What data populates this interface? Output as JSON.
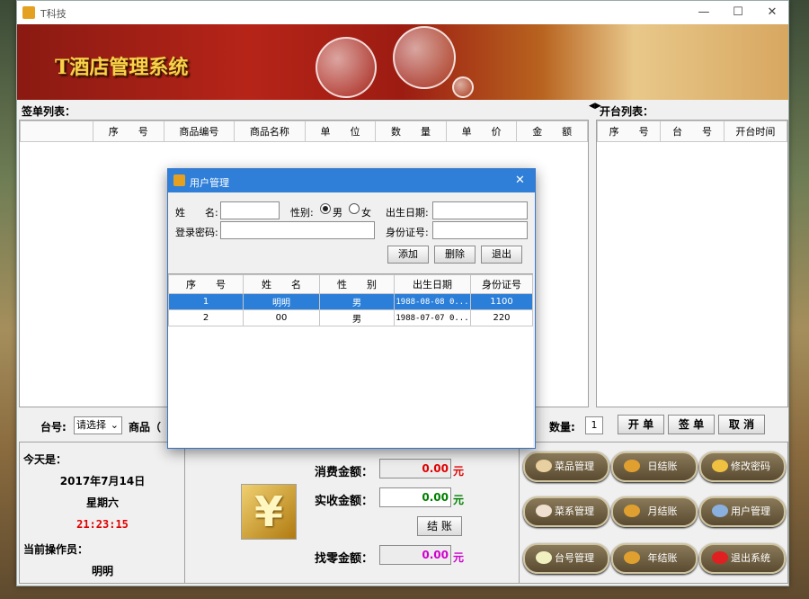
{
  "window": {
    "title": "T科技"
  },
  "banner": {
    "logo": "T酒店管理系统"
  },
  "left_section": {
    "title": "签单列表：",
    "columns": [
      "",
      "序　　号",
      "商品编号",
      "商品名称",
      "单　　位",
      "数　　量",
      "单　　价",
      "金　　额"
    ]
  },
  "right_section": {
    "title": "开台列表：",
    "columns": [
      "序　　号",
      "台　　号",
      "开台时间"
    ]
  },
  "bottom_bar": {
    "table_label": "台号:",
    "table_select": "请选择",
    "goods_label": "商品（",
    "quantity_label": "数量:",
    "quantity_value": "1",
    "open_btn": "开 单",
    "sign_btn": "签 单",
    "cancel_btn": "取 消"
  },
  "info": {
    "today_label": "今天是：",
    "date": "2017年7月14日",
    "weekday": "星期六",
    "time": "21:23:15",
    "operator_label": "当前操作员：",
    "operator": "明明"
  },
  "money": {
    "consume_label": "消费金额：",
    "consume_value": "0.00",
    "consume_unit": "元",
    "received_label": "实收金额：",
    "received_value": "0.00",
    "received_unit": "元",
    "settle_btn": "结 账",
    "change_label": "找零金额：",
    "change_value": "0.00",
    "change_unit": "元"
  },
  "menu_buttons": {
    "dish": "菜品管理",
    "daily": "日结账",
    "password": "修改密码",
    "category": "菜系管理",
    "monthly": "月结账",
    "user": "用户管理",
    "table": "台号管理",
    "yearly": "年结账",
    "exit": "退出系统"
  },
  "dialog": {
    "title": "用户管理",
    "name_label": "姓　　名:",
    "gender_label": "性别:",
    "male": "男",
    "female": "女",
    "birth_label": "出生日期:",
    "pwd_label": "登录密码:",
    "id_label": "身份证号:",
    "add": "添加",
    "del": "删除",
    "exit": "退出",
    "columns": [
      "序　　号",
      "姓　　名",
      "性　　别",
      "出生日期",
      "身份证号"
    ],
    "rows": [
      [
        "1",
        "明明",
        "男",
        "1988-08-08 0...",
        "1100"
      ],
      [
        "2",
        "00",
        "男",
        "1988-07-07 0...",
        "220"
      ]
    ]
  },
  "colors": {
    "accent": "#2b7fd9",
    "red_value": "#e00000",
    "green_value": "#008000",
    "pink_value": "#d000d0"
  }
}
